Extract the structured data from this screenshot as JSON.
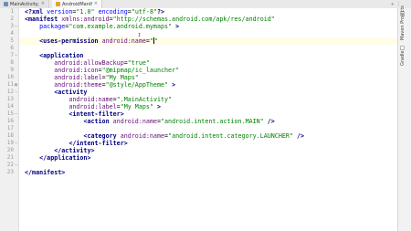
{
  "tabs": [
    {
      "label": "MainActivity.java",
      "active": false
    },
    {
      "label": "AndroidManifest.xml",
      "active": true
    }
  ],
  "window_controls": [
    "+",
    "⋮"
  ],
  "line_numbers": [
    "1",
    "2",
    "3",
    "4",
    "5",
    "6",
    "7",
    "8",
    "9",
    "10",
    "11",
    "12",
    "13",
    "14",
    "15",
    "16",
    "17",
    "18",
    "19",
    "20",
    "21",
    "22",
    "23"
  ],
  "code_lines": [
    {
      "indent": "",
      "parts": [
        {
          "cls": "tag",
          "text": "<?xml "
        },
        {
          "cls": "attr",
          "text": "version"
        },
        {
          "cls": "plain",
          "text": "="
        },
        {
          "cls": "value",
          "text": "\"1.0\""
        },
        {
          "cls": "plain",
          "text": " "
        },
        {
          "cls": "attr",
          "text": "encoding"
        },
        {
          "cls": "plain",
          "text": "="
        },
        {
          "cls": "value",
          "text": "\"utf-8\""
        },
        {
          "cls": "tag",
          "text": "?>"
        }
      ]
    },
    {
      "indent": "",
      "parts": [
        {
          "cls": "tag",
          "text": "<manifest "
        },
        {
          "cls": "ns",
          "text": "xmlns:android"
        },
        {
          "cls": "plain",
          "text": "="
        },
        {
          "cls": "value",
          "text": "\"http://schemas.android.com/apk/res/android\""
        }
      ]
    },
    {
      "indent": "    ",
      "parts": [
        {
          "cls": "attr",
          "text": "package"
        },
        {
          "cls": "plain",
          "text": "="
        },
        {
          "cls": "value",
          "text": "\"com.example.android.mymaps\""
        },
        {
          "cls": "tag",
          "text": " >"
        }
      ]
    },
    {
      "indent": "",
      "parts": []
    },
    {
      "indent": "    ",
      "parts": [
        {
          "cls": "tag",
          "text": "<uses-permission "
        },
        {
          "cls": "ns",
          "text": "android:name"
        },
        {
          "cls": "plain",
          "text": "="
        },
        {
          "cls": "value",
          "text": "\"\""
        }
      ],
      "cursor": true
    },
    {
      "indent": "",
      "parts": []
    },
    {
      "indent": "    ",
      "parts": [
        {
          "cls": "tag",
          "text": "<application"
        }
      ]
    },
    {
      "indent": "        ",
      "parts": [
        {
          "cls": "ns",
          "text": "android:allowBackup"
        },
        {
          "cls": "plain",
          "text": "="
        },
        {
          "cls": "value",
          "text": "\"true\""
        }
      ]
    },
    {
      "indent": "        ",
      "parts": [
        {
          "cls": "ns",
          "text": "android:icon"
        },
        {
          "cls": "plain",
          "text": "="
        },
        {
          "cls": "value",
          "text": "\"@mipmap/ic_launcher\""
        }
      ]
    },
    {
      "indent": "        ",
      "parts": [
        {
          "cls": "ns",
          "text": "android:label"
        },
        {
          "cls": "plain",
          "text": "="
        },
        {
          "cls": "value",
          "text": "\"My Maps\""
        }
      ]
    },
    {
      "indent": "        ",
      "parts": [
        {
          "cls": "ns",
          "text": "android:theme"
        },
        {
          "cls": "plain",
          "text": "="
        },
        {
          "cls": "value",
          "text": "\"@style/AppTheme\""
        },
        {
          "cls": "tag",
          "text": " >"
        }
      ]
    },
    {
      "indent": "        ",
      "parts": [
        {
          "cls": "tag",
          "text": "<activity"
        }
      ]
    },
    {
      "indent": "            ",
      "parts": [
        {
          "cls": "ns",
          "text": "android:name"
        },
        {
          "cls": "plain",
          "text": "="
        },
        {
          "cls": "value",
          "text": "\".MainActivity\""
        }
      ]
    },
    {
      "indent": "            ",
      "parts": [
        {
          "cls": "ns",
          "text": "android:label"
        },
        {
          "cls": "plain",
          "text": "="
        },
        {
          "cls": "value",
          "text": "\"My Maps\""
        },
        {
          "cls": "tag",
          "text": " >"
        }
      ]
    },
    {
      "indent": "            ",
      "parts": [
        {
          "cls": "tag",
          "text": "<intent-filter>"
        }
      ]
    },
    {
      "indent": "                ",
      "parts": [
        {
          "cls": "tag",
          "text": "<action "
        },
        {
          "cls": "ns",
          "text": "android:name"
        },
        {
          "cls": "plain",
          "text": "="
        },
        {
          "cls": "value",
          "text": "\"android.intent.action.MAIN\""
        },
        {
          "cls": "tag",
          "text": " />"
        }
      ]
    },
    {
      "indent": "",
      "parts": []
    },
    {
      "indent": "                ",
      "parts": [
        {
          "cls": "tag",
          "text": "<category "
        },
        {
          "cls": "ns",
          "text": "android:name"
        },
        {
          "cls": "plain",
          "text": "="
        },
        {
          "cls": "value",
          "text": "\"android.intent.category.LAUNCHER\""
        },
        {
          "cls": "tag",
          "text": " />"
        }
      ]
    },
    {
      "indent": "            ",
      "parts": [
        {
          "cls": "tag",
          "text": "</intent-filter>"
        }
      ]
    },
    {
      "indent": "        ",
      "parts": [
        {
          "cls": "tag",
          "text": "</activity>"
        }
      ]
    },
    {
      "indent": "    ",
      "parts": [
        {
          "cls": "tag",
          "text": "</application>"
        }
      ]
    },
    {
      "indent": "",
      "parts": []
    },
    {
      "indent": "",
      "parts": [
        {
          "cls": "tag",
          "text": "</manifest>"
        }
      ]
    }
  ],
  "side_tabs": [
    "Maven Projects",
    "Gradle"
  ],
  "colors": {
    "tag": "#000080",
    "namespace_attr": "#660e7a",
    "string_value": "#008000",
    "current_line": "#fffde7"
  }
}
